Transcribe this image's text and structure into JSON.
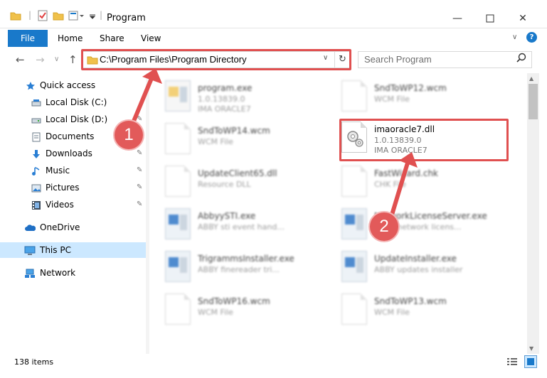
{
  "window": {
    "title": "Program"
  },
  "ribbon": {
    "file": "File",
    "tabs": [
      "Home",
      "Share",
      "View"
    ],
    "help": "?"
  },
  "address": {
    "path": "C:\\Program Files\\Program Directory"
  },
  "search": {
    "placeholder": "Search Program"
  },
  "sidebar": {
    "quick_access": "Quick access",
    "items": [
      {
        "label": "Local Disk (C:)",
        "icon": "drive-icon"
      },
      {
        "label": "Local Disk (D:)",
        "icon": "drive-icon"
      },
      {
        "label": "Documents",
        "icon": "documents-icon"
      },
      {
        "label": "Downloads",
        "icon": "downloads-icon"
      },
      {
        "label": "Music",
        "icon": "music-icon"
      },
      {
        "label": "Pictures",
        "icon": "pictures-icon"
      },
      {
        "label": "Videos",
        "icon": "videos-icon"
      }
    ],
    "onedrive": "OneDrive",
    "thispc": "This PC",
    "network": "Network"
  },
  "files": [
    {
      "name": "program.exe",
      "desc": "1.0.13839.0",
      "company": "IMA ORACLE7",
      "icon": "exe-icon"
    },
    {
      "name": "SndToWP12.wcm",
      "desc": "WCM File",
      "company": "",
      "icon": "document-icon"
    },
    {
      "name": "SndToWP14.wcm",
      "desc": "WCM File",
      "company": "",
      "icon": "document-icon"
    },
    {
      "name": "imaoracle7.dll",
      "desc": "1.0.13839.0",
      "company": "IMA ORACLE7",
      "icon": "dll-icon"
    },
    {
      "name": "UpdateClient65.dll",
      "desc": "Resource DLL",
      "company": "",
      "icon": "dll-icon"
    },
    {
      "name": "FastWizard.chk",
      "desc": "CHK File",
      "company": "",
      "icon": "document-icon"
    },
    {
      "name": "AbbyySTI.exe",
      "desc": "ABBY sti event hand...",
      "company": "",
      "icon": "app-icon"
    },
    {
      "name": "NetworkLicenseServer.exe",
      "desc": "ABBY network licens...",
      "company": "",
      "icon": "app-icon"
    },
    {
      "name": "TrigrammsInstaller.exe",
      "desc": "ABBY finereader tri...",
      "company": "",
      "icon": "app-icon"
    },
    {
      "name": "UpdateInstaller.exe",
      "desc": "ABBY updates installer",
      "company": "",
      "icon": "app-icon"
    },
    {
      "name": "SndToWP16.wcm",
      "desc": "WCM File",
      "company": "",
      "icon": "document-icon"
    },
    {
      "name": "SndToWP13.wcm",
      "desc": "WCM File",
      "company": "",
      "icon": "document-icon"
    }
  ],
  "status": {
    "count": "138 items"
  },
  "callouts": [
    "1",
    "2"
  ]
}
